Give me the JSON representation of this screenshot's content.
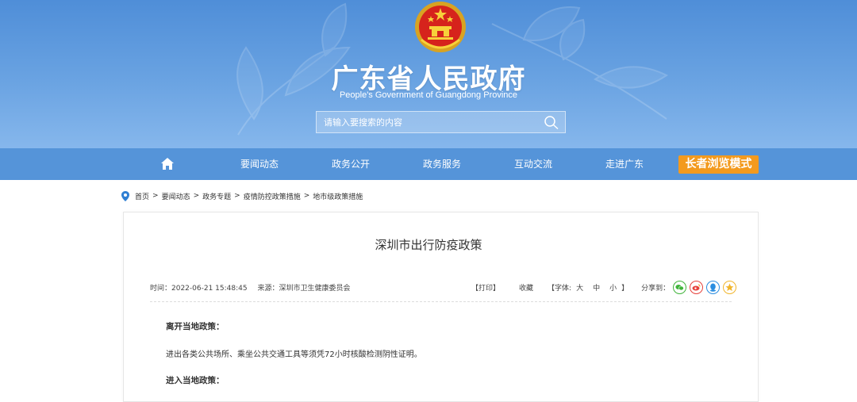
{
  "header": {
    "title": "广东省人民政府",
    "subtitle": "People's Government of Guangdong Province",
    "search_placeholder": "请输入要搜索的内容"
  },
  "nav": {
    "items": [
      {
        "label": "要闻动态"
      },
      {
        "label": "政务公开"
      },
      {
        "label": "政务服务"
      },
      {
        "label": "互动交流"
      },
      {
        "label": "走进广东"
      }
    ],
    "elder_mode_label": "长者浏览模式"
  },
  "breadcrumb": {
    "items": [
      "首页",
      "要闻动态",
      "政务专题",
      "疫情防控政策措施",
      "地市级政策措施"
    ],
    "separator": ">"
  },
  "article": {
    "title": "深圳市出行防疫政策",
    "time_label": "时间：2022-06-21 15:48:45",
    "source_label": "来源：深圳市卫生健康委员会",
    "print_label": "【打印】",
    "favorite_label": "收藏",
    "font_label": "【字体:",
    "font_large": "大",
    "font_medium": "中",
    "font_small": "小",
    "font_close": "】",
    "share_label": "分享到：",
    "share_icons": [
      "wechat-icon",
      "weibo-icon",
      "qq-icon",
      "qzone-icon"
    ],
    "sections": {
      "leave_heading": "离开当地政策：",
      "leave_text": "进出各类公共场所、乘坐公共交通工具等须凭72小时核酸检测阴性证明。",
      "enter_heading": "进入当地政策："
    }
  },
  "colors": {
    "header_top": "#4f8ed8",
    "nav_bg": "#5594d9",
    "elder_btn": "#f39a1e",
    "wechat": "#3fb43a",
    "weibo": "#e6423c",
    "qq": "#2a8de0",
    "qzone": "#f1b52c"
  }
}
